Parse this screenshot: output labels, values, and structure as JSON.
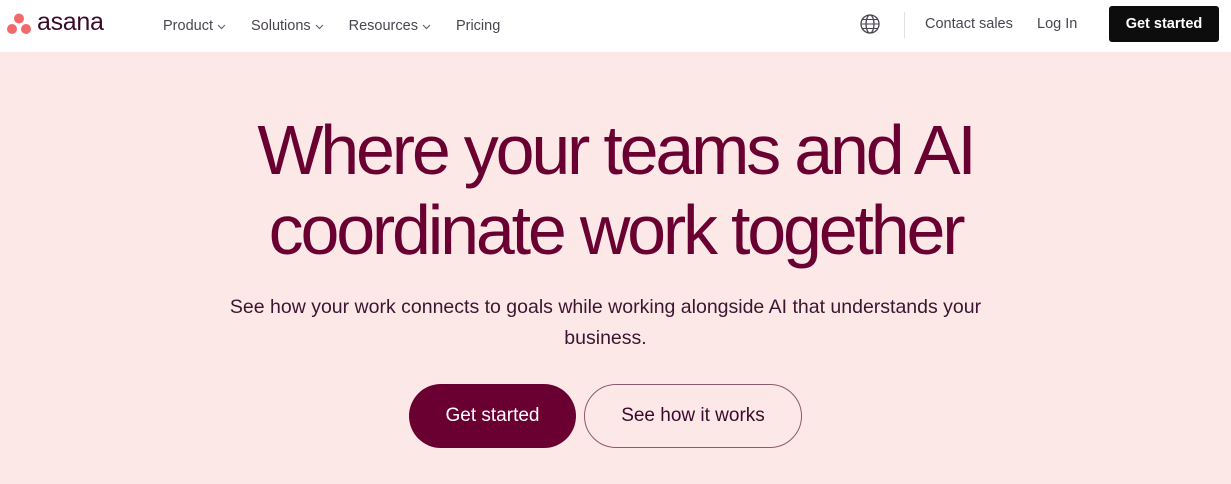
{
  "brand": {
    "wordmark": "asana",
    "logo_color": "#f06a6a"
  },
  "nav": {
    "items": [
      {
        "label": "Product",
        "has_dropdown": true
      },
      {
        "label": "Solutions",
        "has_dropdown": true
      },
      {
        "label": "Resources",
        "has_dropdown": true
      },
      {
        "label": "Pricing",
        "has_dropdown": false
      }
    ],
    "language_icon": "globe-icon",
    "contact_label": "Contact sales",
    "login_label": "Log In",
    "cta_label": "Get started"
  },
  "hero": {
    "headline_line1": "Where your teams and AI",
    "headline_line2": "coordinate work together",
    "subtext": "See how your work connects to goals while working alongside AI that understands your business.",
    "primary_cta": "Get started",
    "secondary_cta": "See how it works",
    "background_color": "#fde8e8",
    "headline_color": "#690031"
  }
}
